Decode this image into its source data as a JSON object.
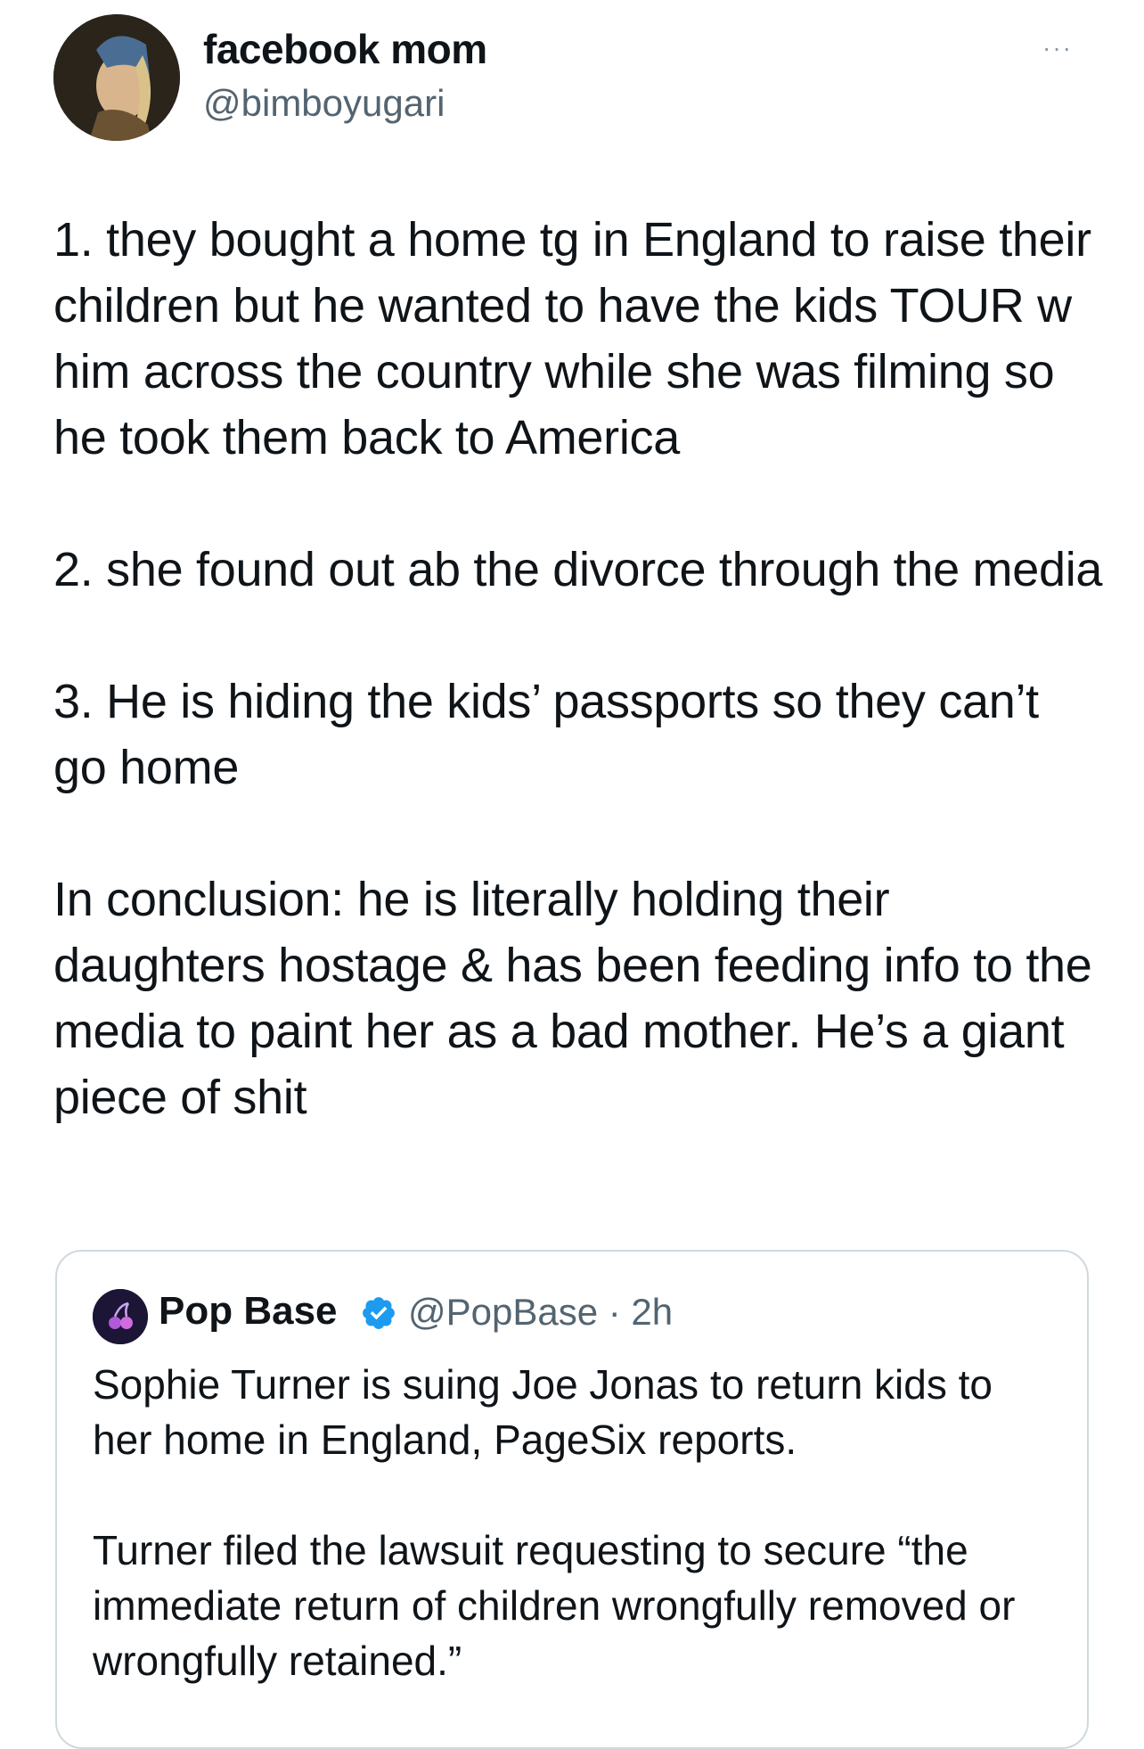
{
  "author": {
    "display_name": "facebook mom",
    "handle": "@bimboyugari",
    "more_label": "···"
  },
  "tweet": {
    "paragraphs": [
      "1. they bought a home tg in England to raise their children but he wanted to have the kids TOUR w him across the country while she was filming so he took them back to America",
      "2. she found out ab the divorce through the media",
      "3. He is hiding the kids’ passports so they can’t go home",
      "In conclusion: he is literally holding their daughters hostage & has been feeding info to the media to paint her as a bad mother. He’s a giant piece of shit"
    ]
  },
  "quoted_tweet": {
    "display_name": "Pop Base",
    "handle_time": "@PopBase · 2h",
    "paragraphs": [
      "Sophie Turner is suing Joe Jonas to return kids to her home in England, PageSix reports.",
      "Turner filed the lawsuit requesting to secure “the immediate return of children wrongfully removed or wrongfully retained.”"
    ]
  },
  "colors": {
    "text": "#0f1419",
    "secondary": "#536471",
    "verified": "#1d9bf0",
    "border": "#cfd9de"
  }
}
